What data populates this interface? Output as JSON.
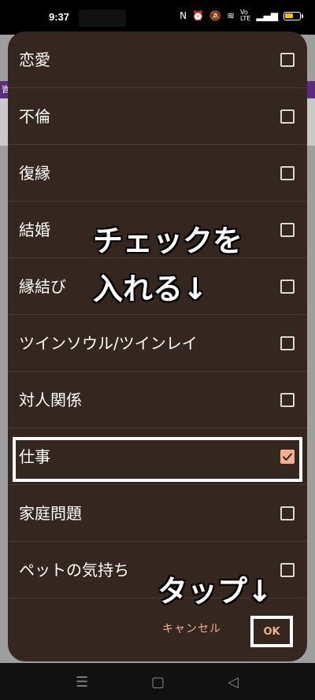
{
  "status_bar": {
    "time": "9:37",
    "icons": [
      "nfc-icon",
      "alarm-icon",
      "mute-icon",
      "wifi-icon",
      "volte-icon",
      "signal-icon",
      "battery-icon"
    ]
  },
  "background": {
    "strip_text": "旹"
  },
  "dialog": {
    "options": [
      {
        "label": "恋愛",
        "checked": false
      },
      {
        "label": "不倫",
        "checked": false
      },
      {
        "label": "復縁",
        "checked": false
      },
      {
        "label": "結婚",
        "checked": false
      },
      {
        "label": "縁結び",
        "checked": false
      },
      {
        "label": "ツインソウル/ツインレイ",
        "checked": false
      },
      {
        "label": "対人関係",
        "checked": false
      },
      {
        "label": "仕事",
        "checked": true
      },
      {
        "label": "家庭問題",
        "checked": false
      },
      {
        "label": "ペットの気持ち",
        "checked": false
      }
    ],
    "cancel_label": "キャンセル",
    "ok_label": "OK"
  },
  "annotations": {
    "line1": "チェックを",
    "line2": "入れる↓",
    "line3": "タップ↓"
  },
  "colors": {
    "dialog_bg": "#35271f",
    "accent": "#f4b08a",
    "divider": "#4a3c33"
  }
}
